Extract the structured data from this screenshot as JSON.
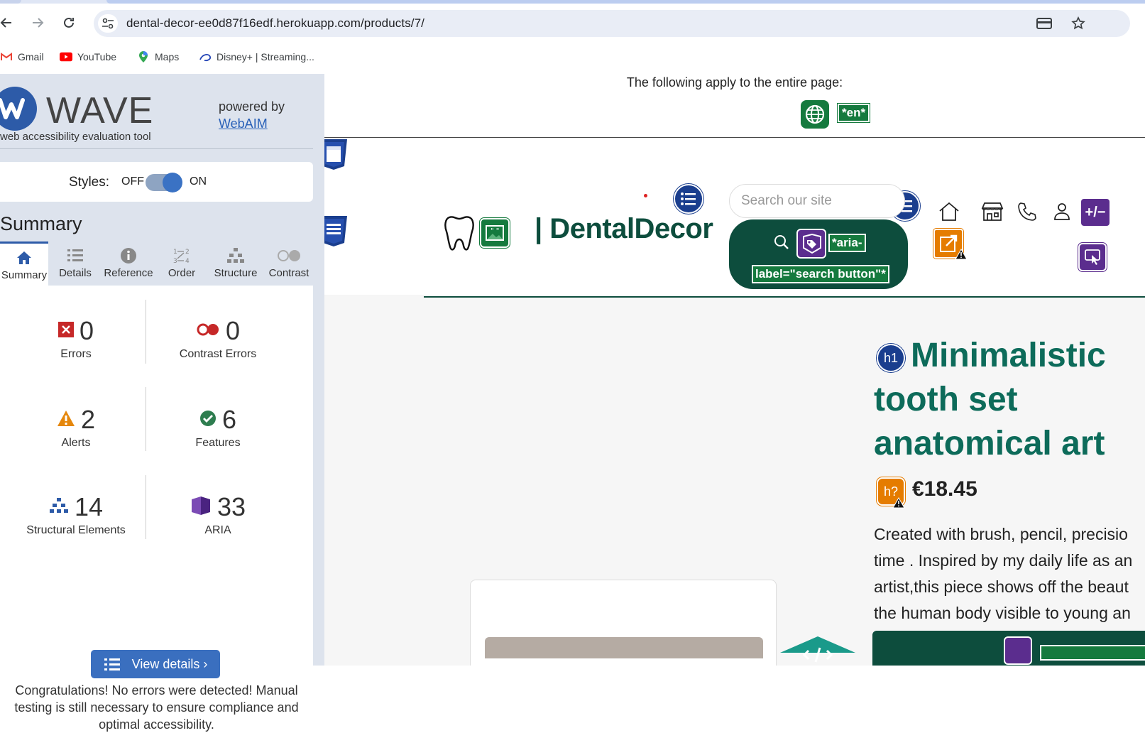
{
  "browser": {
    "url": "dental-decor-ee0d87f16edf.herokuapp.com/products/7/",
    "bookmarks": [
      {
        "label": "Gmail",
        "icon": "gmail-icon"
      },
      {
        "label": "YouTube",
        "icon": "youtube-icon"
      },
      {
        "label": "Maps",
        "icon": "maps-icon"
      },
      {
        "label": "Disney+ | Streaming...",
        "icon": "disney-icon"
      }
    ]
  },
  "wave": {
    "logo_text": "WAVE",
    "tagline": "web accessibility evaluation tool",
    "powered_by": "powered by",
    "webaim_link": "WebAIM",
    "styles_label": "Styles:",
    "styles_off": "OFF",
    "styles_on": "ON",
    "summary_heading": "Summary",
    "tabs": [
      {
        "label": "Summary",
        "icon": "home-icon",
        "active": true
      },
      {
        "label": "Details",
        "icon": "list-icon",
        "active": false
      },
      {
        "label": "Reference",
        "icon": "info-icon",
        "active": false
      },
      {
        "label": "Order",
        "icon": "order-icon",
        "active": false
      },
      {
        "label": "Structure",
        "icon": "structure-icon",
        "active": false
      },
      {
        "label": "Contrast",
        "icon": "contrast-icon",
        "active": false
      }
    ],
    "stats": {
      "errors": {
        "value": "0",
        "label": "Errors"
      },
      "contrast_errors": {
        "value": "0",
        "label": "Contrast Errors"
      },
      "alerts": {
        "value": "2",
        "label": "Alerts"
      },
      "features": {
        "value": "6",
        "label": "Features"
      },
      "structural": {
        "value": "14",
        "label": "Structural Elements"
      },
      "aria": {
        "value": "33",
        "label": "ARIA"
      }
    },
    "view_details": "View details ›",
    "congrats": "Congratulations! No errors were detected! Manual testing is still necessary to ensure compliance and optimal accessibility."
  },
  "page": {
    "page_wide_title": "The following apply to the entire page:",
    "lang_tag": "*en*",
    "brand": "| DentalDecor",
    "search_placeholder": "Search our site",
    "aria_label_line1": "*aria-",
    "aria_label_line2": "label=\"search button\"*",
    "h1_badge": "h1",
    "hq_badge": "h?",
    "product_title": "Minimalistic tooth set anatomical art",
    "price": "€18.45",
    "description_lines": [
      "Created with brush, pencil, precisio",
      "time . Inspired by my daily life as an",
      "artist,this piece shows off the beaut",
      "the human body visible to young an"
    ]
  },
  "colors": {
    "wave_blue": "#2d5ba8",
    "feature_green": "#157a3e",
    "brand_dark_green": "#0d4d3d",
    "title_teal": "#0d6b5a",
    "alert_orange": "#e57c00",
    "aria_purple": "#5b2d8e"
  }
}
